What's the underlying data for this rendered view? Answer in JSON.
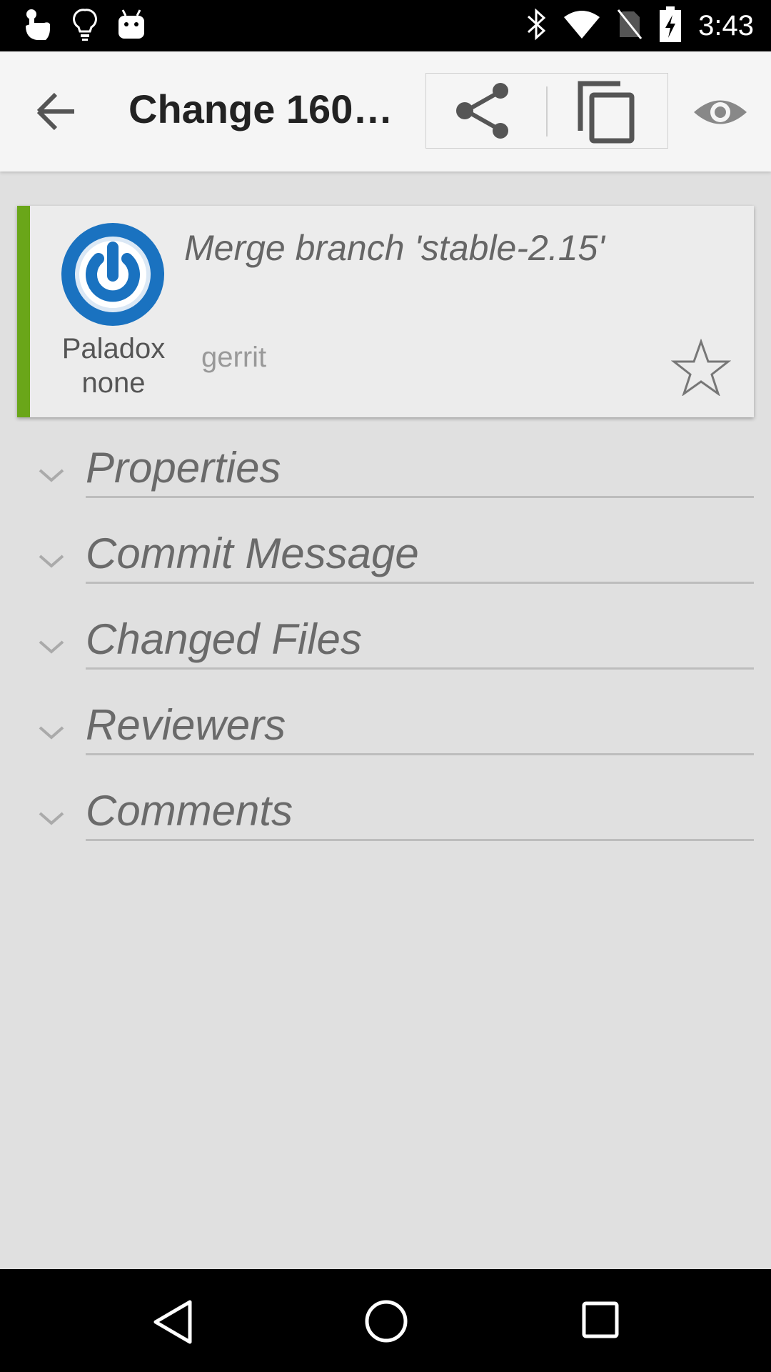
{
  "status_bar": {
    "time": "3:43",
    "left_icons": [
      "touch-icon",
      "lightbulb-icon",
      "android-icon"
    ],
    "right_icons": [
      "bluetooth-icon",
      "wifi-icon",
      "no-sim-icon",
      "battery-charging-icon"
    ]
  },
  "app_bar": {
    "title": "Change 1604…",
    "actions": [
      "share-icon",
      "copy-icon",
      "eye-icon"
    ]
  },
  "change_card": {
    "accent_color": "#6aa619",
    "owner_name_line1": "Paladox",
    "owner_name_line2": "none",
    "subject": "Merge branch 'stable-2.15'",
    "project": "gerrit",
    "starred": false
  },
  "sections": [
    {
      "label": "Properties"
    },
    {
      "label": "Commit Message"
    },
    {
      "label": "Changed Files"
    },
    {
      "label": "Reviewers"
    },
    {
      "label": "Comments"
    }
  ]
}
